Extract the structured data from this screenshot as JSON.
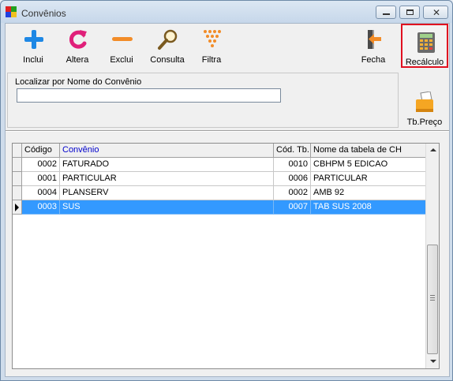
{
  "window": {
    "title": "Convênios"
  },
  "toolbar": {
    "buttons": [
      {
        "label": "Inclui",
        "icon": "plus-icon"
      },
      {
        "label": "Altera",
        "icon": "refresh-icon"
      },
      {
        "label": "Exclui",
        "icon": "minus-icon"
      },
      {
        "label": "Consulta",
        "icon": "magnifier-icon"
      },
      {
        "label": "Filtra",
        "icon": "filter-icon"
      },
      {
        "label": "Fecha",
        "icon": "exit-door-icon"
      }
    ]
  },
  "sidebar": {
    "recalculo_label": "Recálculo",
    "tbpreco_label": "Tb.Preço"
  },
  "search": {
    "label": "Localizar por Nome do Convênio",
    "value": ""
  },
  "grid": {
    "columns": [
      "Código",
      "Convênio",
      "Cód. Tb.",
      "Nome da tabela de CH"
    ],
    "rows": [
      {
        "codigo": "0002",
        "convenio": "FATURADO",
        "cod_tb": "0010",
        "tabela": "CBHPM 5 EDICAO",
        "selected": false
      },
      {
        "codigo": "0001",
        "convenio": "PARTICULAR",
        "cod_tb": "0006",
        "tabela": "PARTICULAR",
        "selected": false
      },
      {
        "codigo": "0004",
        "convenio": "PLANSERV",
        "cod_tb": "0002",
        "tabela": "AMB 92",
        "selected": false
      },
      {
        "codigo": "0003",
        "convenio": "SUS",
        "cod_tb": "0007",
        "tabela": "TAB SUS 2008",
        "selected": true
      }
    ]
  },
  "colors": {
    "selection": "#3399ff",
    "highlight_border": "#e01020",
    "sorted_header_text": "#0000cc"
  }
}
